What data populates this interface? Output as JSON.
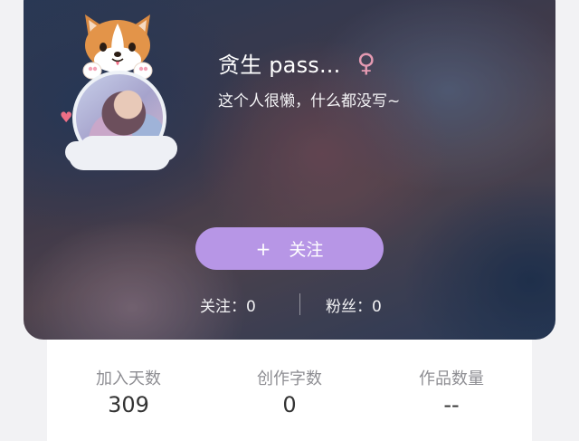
{
  "profile": {
    "name": "贪生 pass...",
    "gender_icon": "♀",
    "bio": "这个人很懒，什么都没写~",
    "follow_button": {
      "icon": "+",
      "label": "关注",
      "color": "#b796e6"
    },
    "following": "关注：0",
    "fans": "粉丝：0"
  },
  "stats": [
    {
      "label": "加入天数",
      "value": "309"
    },
    {
      "label": "创作字数",
      "value": "0"
    },
    {
      "label": "作品数量",
      "value": "--"
    }
  ],
  "icons": {
    "gender": "female-symbol-icon",
    "avatar_frame": "corgi-frame-icon",
    "heart": "heart-icon"
  }
}
